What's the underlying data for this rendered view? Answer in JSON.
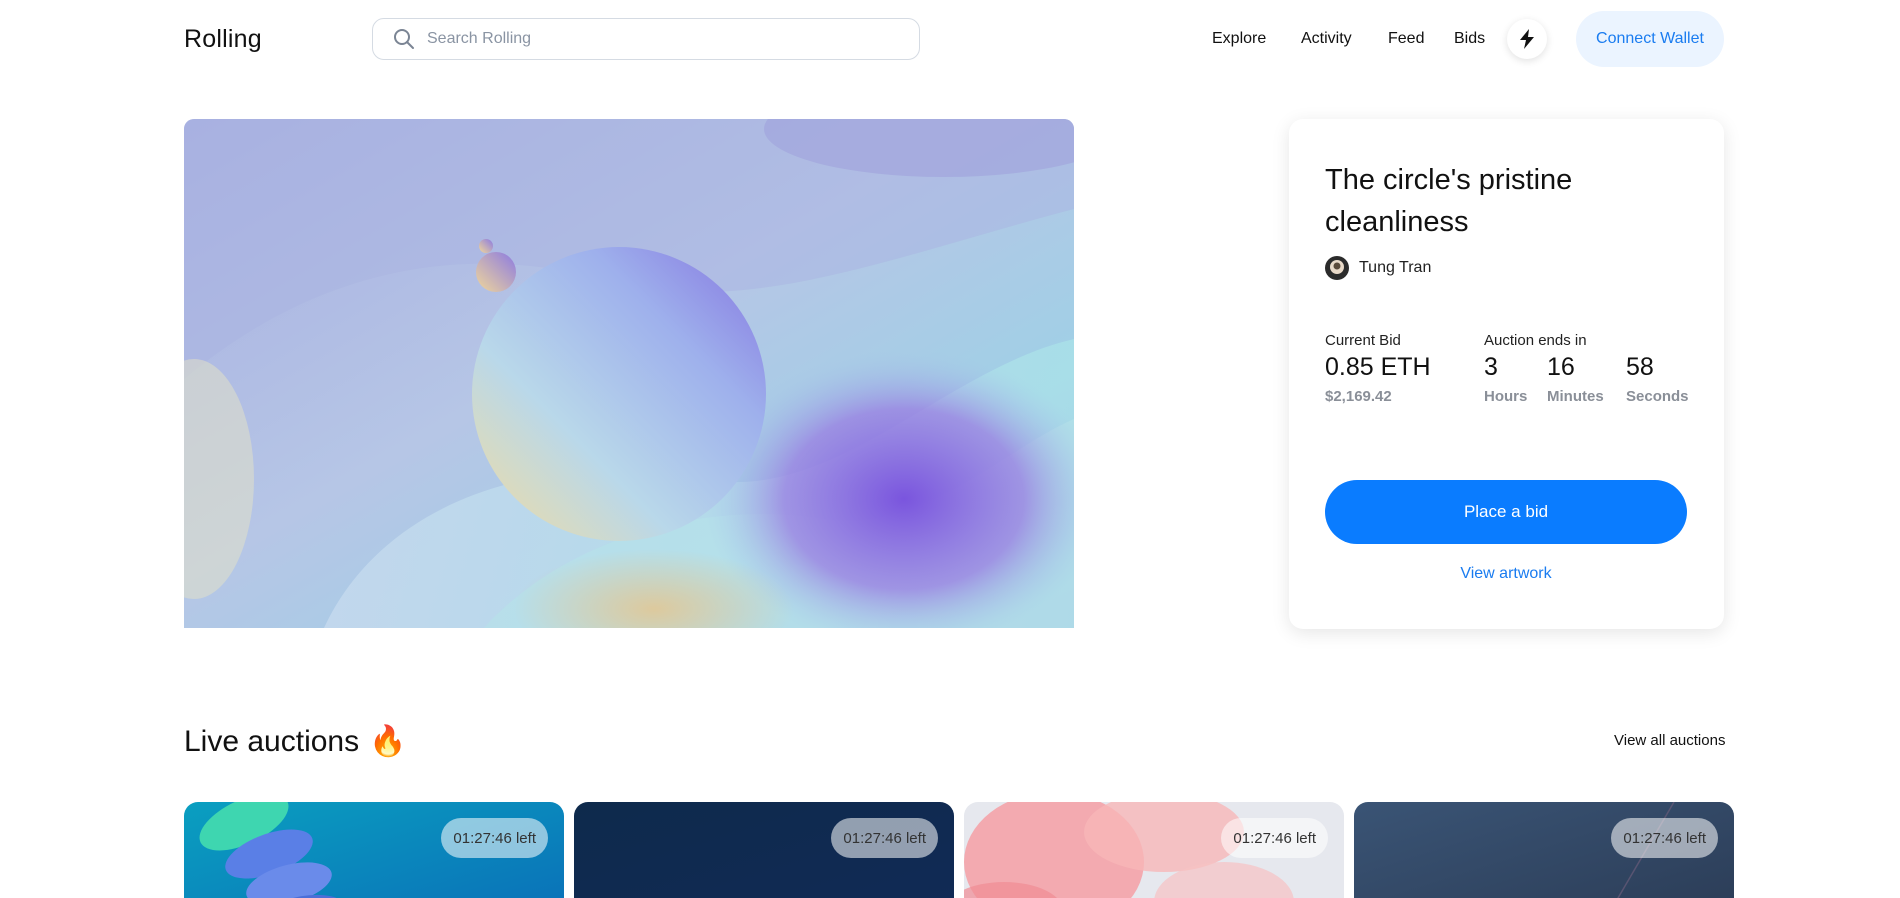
{
  "header": {
    "logo": "Rolling",
    "search_placeholder": "Search Rolling",
    "nav": [
      "Explore",
      "Activity",
      "Feed",
      "Bids"
    ],
    "connect_wallet": "Connect Wallet"
  },
  "featured": {
    "title": "The circle's pristine cleanliness",
    "artist": "Tung Tran",
    "current_bid_label": "Current Bid",
    "current_bid_eth": "0.85 ETH",
    "current_bid_usd": "$2,169.42",
    "auction_ends_label": "Auction ends in",
    "countdown": [
      {
        "value": "3",
        "unit": "Hours"
      },
      {
        "value": "16",
        "unit": "Minutes"
      },
      {
        "value": "58",
        "unit": "Seconds"
      }
    ],
    "place_bid": "Place a bid",
    "view_artwork": "View artwork"
  },
  "live": {
    "title": "Live auctions",
    "emoji": "🔥",
    "view_all": "View all auctions",
    "items": [
      {
        "time_left": "01:27:46 left"
      },
      {
        "time_left": "01:27:46 left"
      },
      {
        "time_left": "01:27:46 left"
      },
      {
        "time_left": "01:27:46 left"
      }
    ]
  },
  "colors": {
    "accent": "#0a7cff",
    "wallet_bg": "#ebf4ff",
    "muted": "#8a8f98"
  }
}
